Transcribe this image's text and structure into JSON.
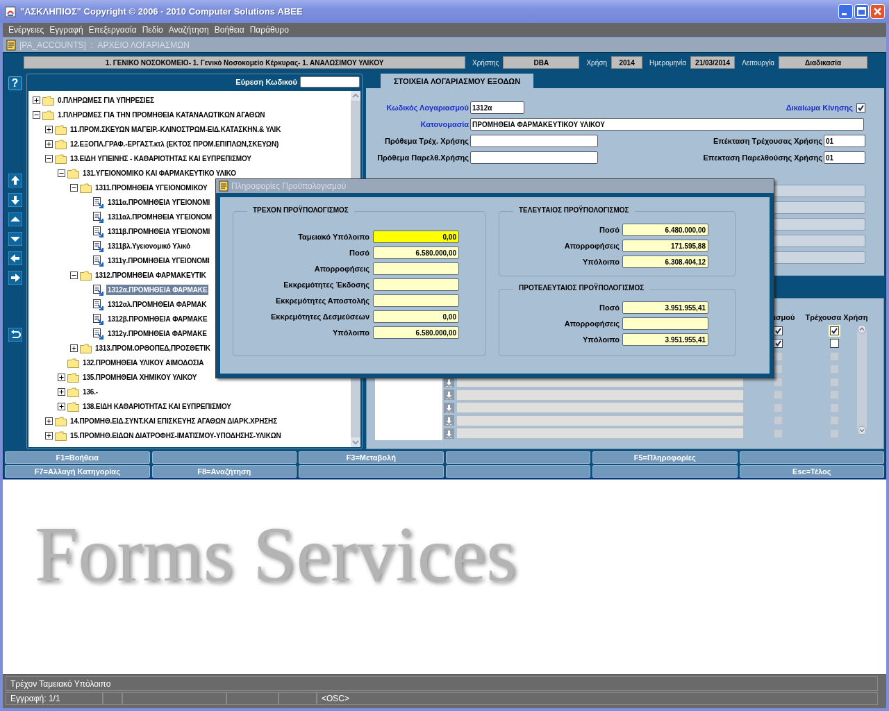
{
  "window": {
    "title": "\"ΑΣΚΛΗΠΙΟΣ\" Copyright © 2006 - 2010 Computer Solutions ΑΒΕΕ"
  },
  "menu": [
    "Ενέργειες",
    "Εγγραφή",
    "Επεξεργασία",
    "Πεδίο",
    "Αναζήτηση",
    "Βοήθεια",
    "Παράθυρο"
  ],
  "form_window": {
    "title": "[PA_ACCOUNTS]  :  ΑΡΧΕΙΟ ΛΟΓΑΡΙΑΣΜΩΝ"
  },
  "header": {
    "organization": "1. ΓΕΝΙΚΟ ΝΟΣΟΚΟΜΕΙΟ- 1. Γενικό Νοσοκομείο Κέρκυρας- 1. ΑΝΑΛΩΣΙΜΟΥ ΥΛΙΚΟΥ",
    "fields": [
      {
        "label": "Χρήστης",
        "value": "DBA"
      },
      {
        "label": "Χρήση",
        "value": "2014"
      },
      {
        "label": "Ημερομηνία",
        "value": "21/03/2014"
      },
      {
        "label": "Λειτουργία",
        "value": "Διαδικασία"
      }
    ]
  },
  "toolbar": {
    "help_button": "?"
  },
  "tree": {
    "search_label": "Εύρεση Κωδικού",
    "items": [
      {
        "label": "0.ΠΛΗΡΩΜΕΣ ΓΙΑ ΥΠΗΡΕΣΙΕΣ",
        "kind": "folder",
        "expanded": false
      },
      {
        "label": "1.ΠΛΗΡΩΜΕΣ ΓΙΑ ΤΗΝ ΠΡΟΜΗΘΕΙΑ ΚΑΤΑΝΑΛΩΤΙΚΩΝ ΑΓΑΘΩΝ",
        "kind": "folder",
        "expanded": true,
        "children": [
          {
            "label": "11.ΠΡΟΜ.ΣΚΕΥΩΝ ΜΑΓΕΙΡ.-ΚΛΙΝΟΣΤΡΩΜ-ΕΙΔ.ΚΑΤΑΣΚΗΝ.& ΥΛΙΚ",
            "kind": "folder",
            "expanded": false
          },
          {
            "label": "12.ΕΞΟΠΛ.ΓΡΑΦ.-ΕΡΓΑΣΤ.κτλ (ΕΚΤΟΣ ΠΡΟΜ.ΕΠΙΠΛΩΝ,ΣΚΕΥΩΝ)",
            "kind": "folder",
            "expanded": false
          },
          {
            "label": "13.ΕΙΔΗ ΥΓΙΕΙΝΗΣ - ΚΑΘΑΡΙΟΤΗΤΑΣ ΚΑΙ ΕΥΠΡΕΠΙΣΜΟΥ",
            "kind": "folder",
            "expanded": true,
            "children": [
              {
                "label": "131.ΥΓΕΙΟΝΟΜΙΚΟ ΚΑΙ ΦΑΡΜΑΚΕΥΤΙΚΟ ΥΛΙΚΟ",
                "kind": "folder",
                "expanded": true,
                "children": [
                  {
                    "label": "1311.ΠΡΟΜΗΘΕΙΑ ΥΓΕΙΟΝΟΜΙΚΟΥ",
                    "kind": "folder",
                    "expanded": true,
                    "children": [
                      {
                        "label": "1311α.ΠΡΟΜΗΘΕΙΑ ΥΓΕΙΟΝΟΜΙ",
                        "kind": "leaf",
                        "selected": false
                      },
                      {
                        "label": "1311αλ.ΠΡΟΜΗΘΕΙΑ ΥΓΕΙΟΝΟΜ",
                        "kind": "leaf",
                        "selected": false
                      },
                      {
                        "label": "1311β.ΠΡΟΜΗΘΕΙΑ ΥΓΕΙΟΝΟΜΙ",
                        "kind": "leaf",
                        "selected": false
                      },
                      {
                        "label": "1311βλ.Υγειονομικό Υλικό",
                        "kind": "leaf",
                        "selected": false
                      },
                      {
                        "label": "1311γ.ΠΡΟΜΗΘΕΙΑ ΥΓΕΙΟΝΟΜΙ",
                        "kind": "leaf",
                        "selected": false
                      }
                    ]
                  },
                  {
                    "label": "1312.ΠΡΟΜΗΘΕΙΑ ΦΑΡΜΑΚΕΥΤΙΚ",
                    "kind": "folder",
                    "expanded": true,
                    "children": [
                      {
                        "label": "1312α.ΠΡΟΜΗΘΕΙΑ ΦΑΡΜΑΚΕ",
                        "kind": "leaf",
                        "selected": true
                      },
                      {
                        "label": "1312αλ.ΠΡΟΜΗΘΕΙΑ ΦΑΡΜΑΚ",
                        "kind": "leaf",
                        "selected": false
                      },
                      {
                        "label": "1312β.ΠΡΟΜΗΘΕΙΑ ΦΑΡΜΑΚΕ",
                        "kind": "leaf",
                        "selected": false
                      },
                      {
                        "label": "1312γ.ΠΡΟΜΗΘΕΙΑ ΦΑΡΜΑΚΕ",
                        "kind": "leaf",
                        "selected": false
                      }
                    ]
                  },
                  {
                    "label": "1313.ΠΡΟΜ.ΟΡΘΟΠΕΔ,ΠΡΟΣΘΕΤΙΚ",
                    "kind": "folder",
                    "expanded": false
                  }
                ]
              },
              {
                "label": "132.ΠΡΟΜΗΘΕΙΑ ΥΛΙΚΟΥ ΑΙΜΟΔΟΣΙΑ",
                "kind": "empty-folder"
              },
              {
                "label": "135.ΠΡΟΜΗΘΕΙΑ ΧΗΜΙΚΟΥ ΥΛΙΚΟΥ",
                "kind": "folder",
                "expanded": false
              },
              {
                "label": "136.-",
                "kind": "folder",
                "expanded": false
              },
              {
                "label": "138.ΕΙΔΗ ΚΑΘΑΡΙΟΤΗΤΑΣ ΚΑΙ ΕΥΠΡΕΠΙΣΜΟΥ",
                "kind": "folder",
                "expanded": false
              }
            ]
          },
          {
            "label": "14.ΠΡΟΜΗΘ.ΕΙΔ.ΣΥΝΤ.ΚΑΙ ΕΠΙΣΚΕΥΗΣ ΑΓΑΘΩΝ ΔΙΑΡΚ.ΧΡΗΣΗΣ",
            "kind": "folder",
            "expanded": false
          },
          {
            "label": "15.ΠΡΟΜΗΘ.ΕΙΔΩΝ ΔΙΑΤΡΟΦΗΣ-ΙΜΑΤΙΣΜΟΥ-ΥΠΟΔΗΣΗΣ-ΥΛΙΚΩΝ",
            "kind": "folder",
            "expanded": false
          }
        ]
      }
    ]
  },
  "account_tab": {
    "label": "ΣΤΟΙΧΕΙΑ ΛΟΓΑΡΙΑΣΜΟΥ ΕΞΟΔΩΝ",
    "selected": true
  },
  "account": {
    "code": {
      "label": "Κωδικός Λογαριασμού",
      "value": "1312α",
      "required": true
    },
    "movement_right": {
      "label": "Δικαίωμα Κίνησης",
      "checked": true
    },
    "name": {
      "label": "Κατονομασία",
      "value": "ΠΡΟΜΗΘΕΙΑ ΦΑΡΜΑΚΕΥΤΙΚΟΥ ΥΛΙΚΟΥ",
      "required": true
    },
    "prefix_current": {
      "label": "Πρόθεμα Τρέχ. Χρήσης",
      "required": false
    },
    "extension_current": {
      "label": "Επέκταση Τρέχουσας Χρήσης",
      "value": "01"
    },
    "prefix_previous": {
      "label": "Πρόθεμα Παρελθ.Χρήσης",
      "required": false
    },
    "extension_previous": {
      "label": "Επεκταση Παρελθούσης Χρήσης",
      "value": "01"
    }
  },
  "table": {
    "columns": [
      "ισμού",
      "Τρέχουσα Χρήση"
    ],
    "rows": [
      {
        "kind": "partial",
        "enabled": true,
        "current": true,
        "first_checked": true,
        "second_checked": true
      },
      {
        "kind": "partial",
        "enabled": true,
        "current": false,
        "first_checked": true,
        "second_checked": false
      },
      {
        "kind": "partial",
        "enabled": false,
        "current": false,
        "first_checked": false,
        "second_checked": false
      },
      {
        "kind": "partial",
        "enabled": false,
        "current": false,
        "first_checked": false,
        "second_checked": false
      },
      {
        "kind": "full",
        "enabled": false,
        "current": false,
        "first_checked": false,
        "second_checked": false
      },
      {
        "kind": "full",
        "enabled": false,
        "current": false,
        "first_checked": false,
        "second_checked": false
      },
      {
        "kind": "full",
        "enabled": false,
        "current": false,
        "first_checked": false,
        "second_checked": false
      },
      {
        "kind": "full",
        "enabled": false,
        "current": false,
        "first_checked": false,
        "second_checked": false
      },
      {
        "kind": "full",
        "enabled": false,
        "current": false,
        "first_checked": false,
        "second_checked": false
      }
    ]
  },
  "function_keys": [
    [
      {
        "kind": "key",
        "label": "F1=Βοήθεια"
      },
      {
        "kind": "blank"
      },
      {
        "kind": "key",
        "label": "F3=Μεταβολή"
      },
      {
        "kind": "blank"
      },
      {
        "kind": "key",
        "label": "F5=Πληροφορίες"
      },
      {
        "kind": "blank"
      }
    ],
    [
      {
        "kind": "key",
        "label": "F7=Αλλαγή Κατηγορίας"
      },
      {
        "kind": "key",
        "label": "F8=Αναζήτηση"
      },
      {
        "kind": "blank"
      },
      {
        "kind": "blank"
      },
      {
        "kind": "blank"
      },
      {
        "kind": "key",
        "label": "Esc=Τέλος"
      }
    ]
  ],
  "background_logo": "Forms Services",
  "budget_dialog": {
    "title": "Πληροφορίες Προϋπολογισμού",
    "groups": [
      {
        "heading": "ΤΡΕΧΟΝ ΠΡΟΫΠΟΛΟΓΙΣΜΟΣ",
        "fields": [
          {
            "label": "Ταμειακό Υπόλοιπο",
            "value": "0,00",
            "focused": true
          },
          {
            "label": "Ποσό",
            "value": "6.580.000,00",
            "focused": false
          },
          {
            "label": "Απορροφήσεις",
            "focused": false
          },
          {
            "label": "Εκκρεμότητες Έκδοσης",
            "focused": false
          },
          {
            "label": "Εκκρεμότητες Αποστολής",
            "focused": false
          },
          {
            "label": "Εκκρεμότητες Δεσμεύσεων",
            "value": "0,00",
            "focused": false
          },
          {
            "label": "Υπόλοιπο",
            "value": "6.580.000,00",
            "focused": false
          }
        ]
      },
      {
        "heading": "ΤΕΛΕΥΤΑΙΟΣ ΠΡΟΫΠΟΛΟΓΙΣΜΟΣ",
        "fields": [
          {
            "label": "Ποσό",
            "value": "6.480.000,00",
            "focused": false
          },
          {
            "label": "Απορροφήσεις",
            "value": "171.595,88",
            "focused": false
          },
          {
            "label": "Υπόλοιπο",
            "value": "6.308.404,12",
            "focused": false
          }
        ]
      },
      {
        "heading": "ΠΡΟΤΕΛΕΥΤΑΙΟΣ ΠΡΟΫΠΟΛΟΓΙΣΜΟΣ",
        "fields": [
          {
            "label": "Ποσό",
            "value": "3.951.955,41",
            "focused": false
          },
          {
            "label": "Απορροφήσεις",
            "focused": false
          },
          {
            "label": "Υπόλοιπο",
            "value": "3.951.955,41",
            "focused": false
          }
        ]
      }
    ]
  },
  "status_bar": {
    "message": "Τρέχον Ταμειακό Υπόλοιπο",
    "record": "Εγγραφή: 1/1",
    "mode": "<OSC>"
  }
}
